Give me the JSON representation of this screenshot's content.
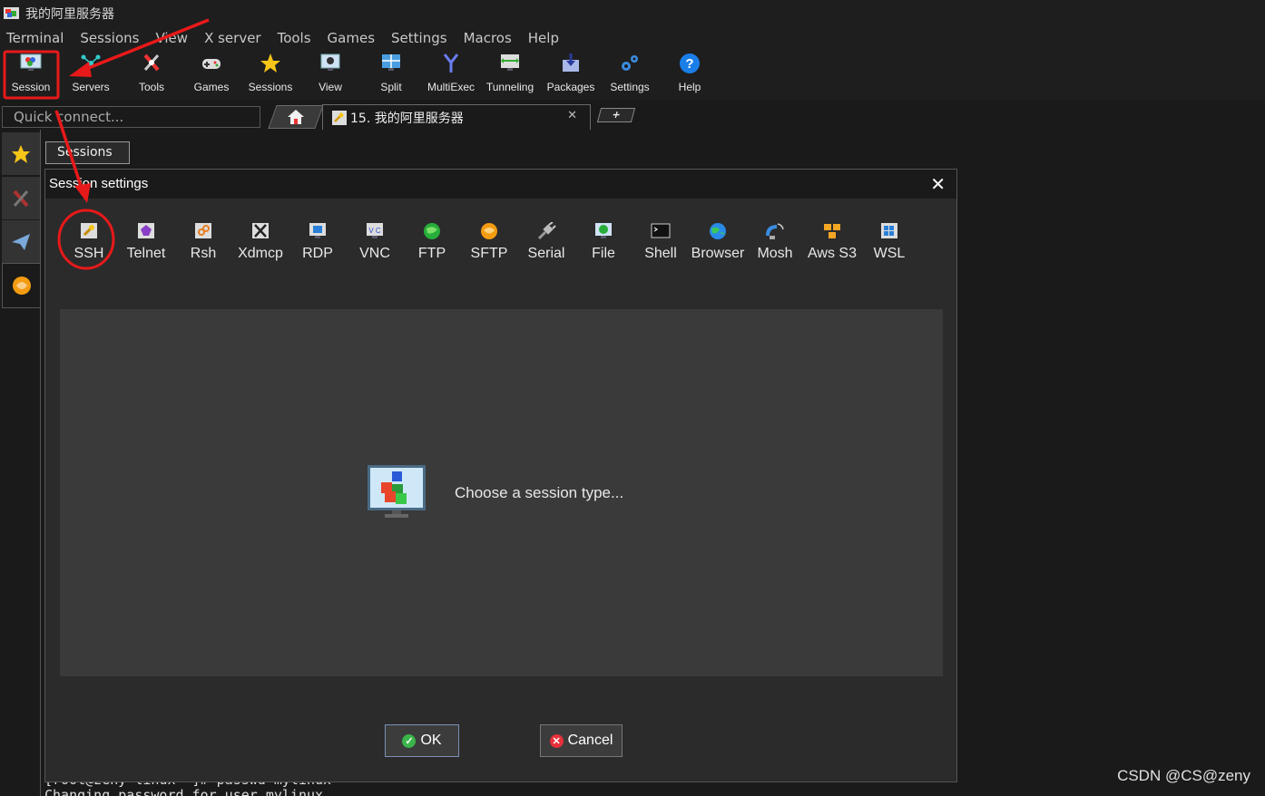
{
  "window": {
    "title": "我的阿里服务器"
  },
  "menu": [
    "Terminal",
    "Sessions",
    "View",
    "X server",
    "Tools",
    "Games",
    "Settings",
    "Macros",
    "Help"
  ],
  "toolbar": [
    {
      "label": "Session",
      "icon": "session-monitor-icon"
    },
    {
      "label": "Servers",
      "icon": "servers-icon"
    },
    {
      "label": "Tools",
      "icon": "tools-icon"
    },
    {
      "label": "Games",
      "icon": "gamepad-icon"
    },
    {
      "label": "Sessions",
      "icon": "star-icon"
    },
    {
      "label": "View",
      "icon": "view-icon"
    },
    {
      "label": "Split",
      "icon": "split-icon"
    },
    {
      "label": "MultiExec",
      "icon": "multiexec-icon"
    },
    {
      "label": "Tunneling",
      "icon": "tunneling-icon"
    },
    {
      "label": "Packages",
      "icon": "packages-icon"
    },
    {
      "label": "Settings",
      "icon": "gears-icon"
    },
    {
      "label": "Help",
      "icon": "help-icon"
    }
  ],
  "quick_connect": {
    "placeholder": "Quick connect..."
  },
  "tabs": {
    "session_tab": "15. 我的阿里服务器",
    "add": "+"
  },
  "sidebar": [
    "star-icon",
    "tools-icon",
    "paper-plane-icon",
    "sftp-icon"
  ],
  "sessions_tab": "Sessions",
  "terminal_lines": [
    "[root@zeny-linux ~]# passwd mylinux",
    "Changing password for user mylinux."
  ],
  "dialog": {
    "title": "Session settings",
    "close": "✕",
    "session_types": [
      "SSH",
      "Telnet",
      "Rsh",
      "Xdmcp",
      "RDP",
      "VNC",
      "FTP",
      "SFTP",
      "Serial",
      "File",
      "Shell",
      "Browser",
      "Mosh",
      "Aws S3",
      "WSL"
    ],
    "choose_text": "Choose a session type...",
    "ok": "OK",
    "cancel": "Cancel"
  },
  "watermark": "CSDN @CS@zeny",
  "colors": {
    "annotation": "#e8191a",
    "dialog_bg": "#2b2b2b",
    "panel_bg": "#3a3a3a"
  }
}
